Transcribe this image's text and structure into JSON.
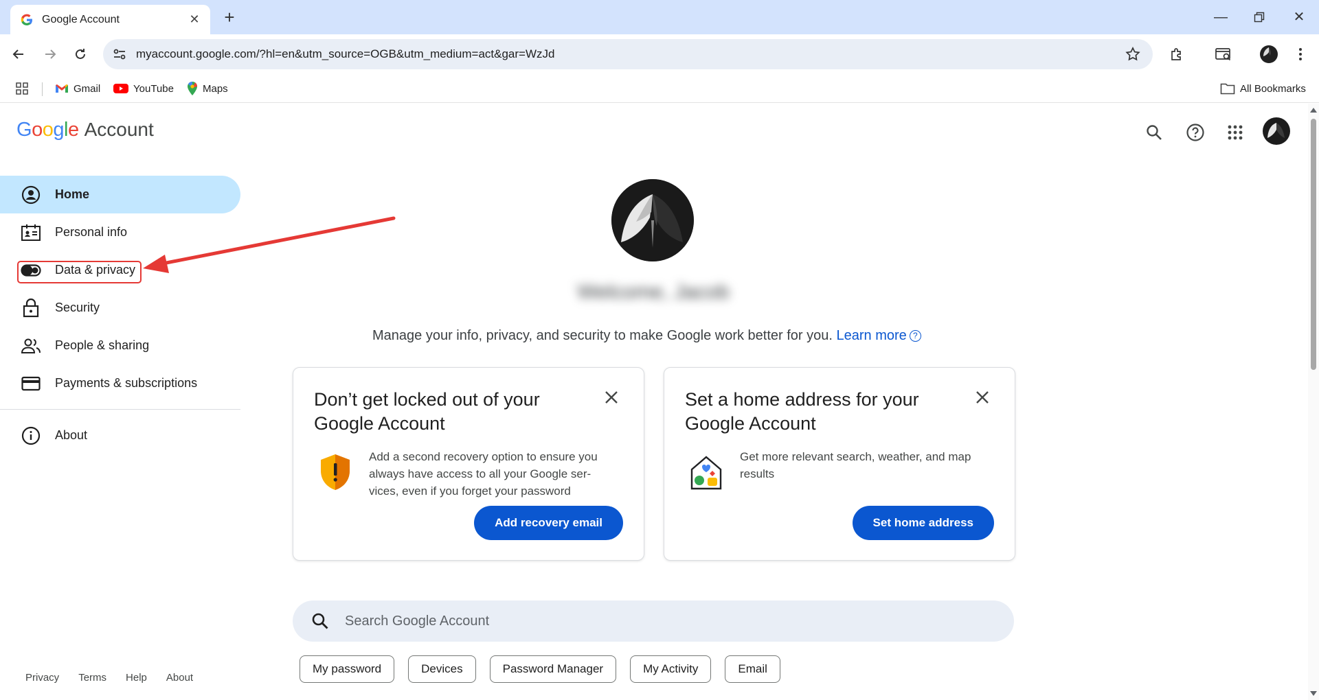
{
  "browser": {
    "tab_title": "Google Account",
    "url": "myaccount.google.com/?hl=en&utm_source=OGB&utm_medium=act&gar=WzJd",
    "bookmarks": [
      {
        "label": "Gmail",
        "icon": "gmail-icon"
      },
      {
        "label": "YouTube",
        "icon": "youtube-icon"
      },
      {
        "label": "Maps",
        "icon": "maps-icon"
      }
    ],
    "all_bookmarks": "All Bookmarks"
  },
  "header": {
    "logo_google": "Google",
    "logo_account": "Account"
  },
  "sidebar": {
    "items": [
      {
        "label": "Home",
        "icon": "home-account-icon",
        "active": true
      },
      {
        "label": "Personal info",
        "icon": "id-card-icon"
      },
      {
        "label": "Data & privacy",
        "icon": "toggle-icon"
      },
      {
        "label": "Security",
        "icon": "lock-icon"
      },
      {
        "label": "People & sharing",
        "icon": "people-icon"
      },
      {
        "label": "Payments & subscriptions",
        "icon": "card-icon"
      }
    ],
    "about": {
      "label": "About",
      "icon": "info-icon"
    },
    "footer": [
      "Privacy",
      "Terms",
      "Help",
      "About"
    ]
  },
  "main": {
    "welcome": "Welcome, Jacob",
    "tagline": "Manage your info, privacy, and security to make Google work better for you.",
    "learn_more": "Learn more",
    "cards": [
      {
        "title": "Don’t get locked out of your Google Account",
        "body": "Add a second recovery option to ensure you always have access to all your Google ser-vices, even if you forget your password",
        "button": "Add recovery email",
        "icon": "shield-warning-icon"
      },
      {
        "title": "Set a home address for your Google Account",
        "body": "Get more relevant search, weather, and map results",
        "button": "Set home address",
        "icon": "home-address-icon"
      }
    ],
    "search_placeholder": "Search Google Account",
    "chips": [
      "My password",
      "Devices",
      "Password Manager",
      "My Activity",
      "Email"
    ]
  },
  "colors": {
    "accent": "#0b57d0",
    "active_nav": "#c2e7ff",
    "annotation": "#e53935"
  }
}
